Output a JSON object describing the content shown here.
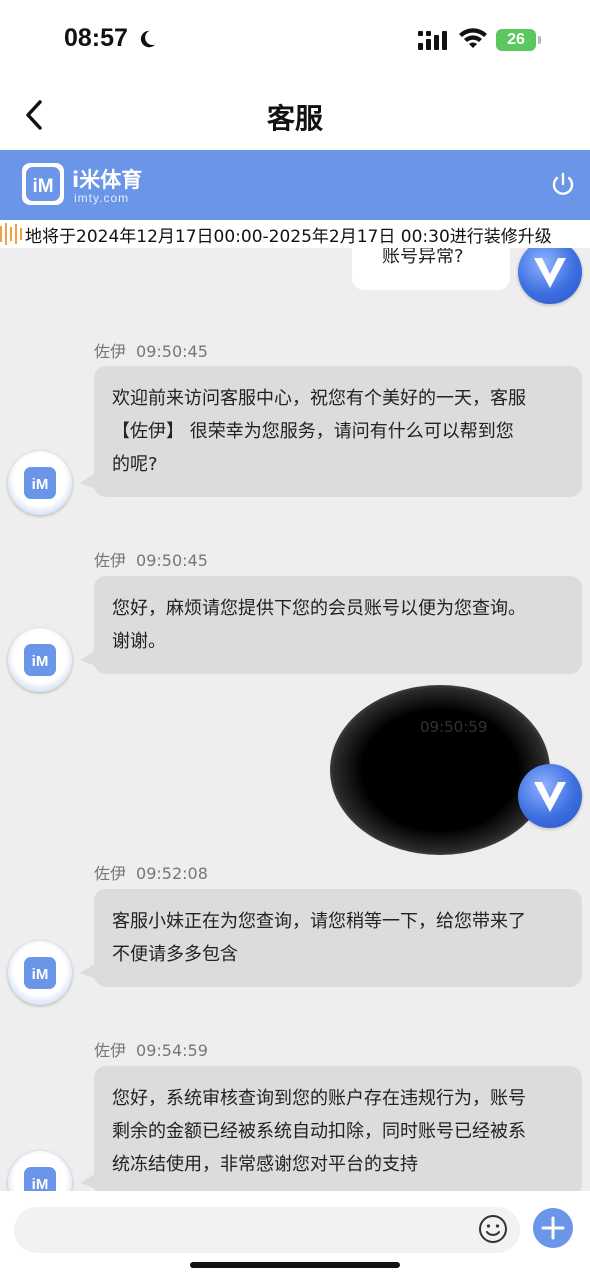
{
  "status_bar": {
    "time": "08:57",
    "battery": "26"
  },
  "nav": {
    "title": "客服"
  },
  "brand": {
    "name": "i米体育",
    "url": "imty.com",
    "logo_text": "iM"
  },
  "notice": {
    "text": "地将于2024年12月17日00:00-2025年2月17日 00:30进行装修升级"
  },
  "top_outgoing_snippet": "账号异常?",
  "messages": [
    {
      "sender": "佐伊",
      "time": "09:50:45",
      "text_lines": [
        "欢迎前来访问客服中心，祝您有个美好的一天，客服",
        "【佐伊】 很荣幸为您服务，请问有什么可以帮到您",
        "的呢?"
      ]
    },
    {
      "sender": "佐伊",
      "time": "09:50:45",
      "text_lines": [
        "您好，麻烦请您提供下您的会员账号以便为您查询。",
        "谢谢。"
      ]
    },
    {
      "sender": "佐伊",
      "time": "09:52:08",
      "text_lines": [
        "客服小妹正在为您查询，请您稍等一下，给您带来了",
        "不便请多多包含"
      ]
    },
    {
      "sender": "佐伊",
      "time": "09:54:59",
      "text_lines": [
        "您好，系统审核查询到您的账户存在违规行为，账号",
        "剩余的金额已经被系统自动扣除，同时账号已经被系",
        "统冻结使用，非常感谢您对平台的支持"
      ]
    }
  ],
  "redacted_time": "09:50:59",
  "input": {
    "placeholder": ""
  },
  "colors": {
    "brand_blue": "#6a95e8",
    "chat_bg": "#eeeeee",
    "bubble_in": "#dcdcdc",
    "battery_green": "#5bc85f"
  }
}
